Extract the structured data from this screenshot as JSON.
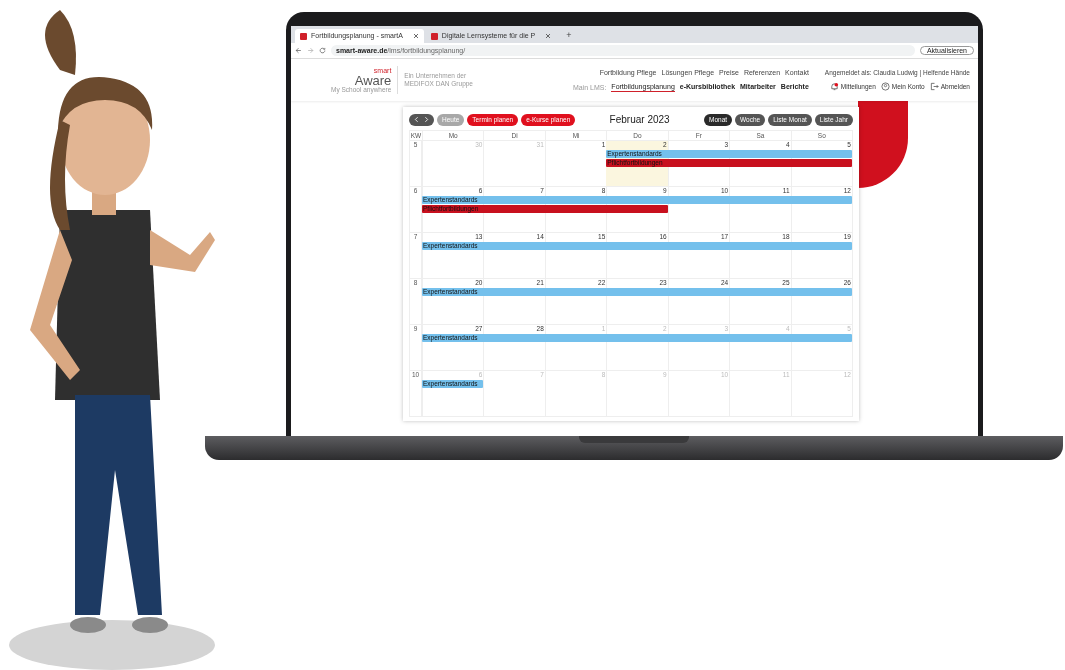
{
  "browser": {
    "tabs": [
      {
        "title": "Fortbildungsplanung - smartA",
        "selected": true
      },
      {
        "title": "Digitale Lernsysteme für die P",
        "selected": false
      }
    ],
    "new_tab": "+",
    "url_host": "smart-aware.de",
    "url_path": "/lms/fortbildungsplanung/",
    "update_button": "Aktualisieren"
  },
  "site": {
    "logo_top": "smart",
    "logo_main": "Aware",
    "logo_tagline": "My School anywhere",
    "company_note": "Ein Unternehmen der MEDIFOX DAN Gruppe",
    "top_nav": [
      "Fortbildung Pflege",
      "Lösungen Pflege",
      "Preise",
      "Referenzen",
      "Kontakt"
    ],
    "user_line": "Angemeldet als: Claudia Ludwig | Helfende Hände",
    "lms_label": "Main LMS:",
    "lms_nav": [
      {
        "label": "Fortbildungsplanung",
        "selected": true
      },
      {
        "label": "e-Kursbibliothek",
        "selected": false
      },
      {
        "label": "Mitarbeiter",
        "selected": false
      },
      {
        "label": "Berichte",
        "selected": false
      }
    ],
    "actions": [
      {
        "kind": "bell",
        "label": "Mitteilungen"
      },
      {
        "kind": "account",
        "label": "Mein Konto"
      },
      {
        "kind": "logout",
        "label": "Abmelden"
      }
    ]
  },
  "calendar": {
    "today_button": {
      "label": "Heute",
      "disabled": true
    },
    "plan_buttons": [
      "Termin planen",
      "e-Kurse planen"
    ],
    "title": "Februar 2023",
    "views": [
      {
        "label": "Monat",
        "selected": true
      },
      {
        "label": "Woche",
        "selected": false
      },
      {
        "label": "Liste Monat",
        "selected": false
      },
      {
        "label": "Liste Jahr",
        "selected": false
      }
    ],
    "week_header": "KW",
    "weekdays": [
      "Mo",
      "Di",
      "Mi",
      "Do",
      "Fr",
      "Sa",
      "So"
    ],
    "weeks": [
      {
        "kw": "5",
        "days": [
          {
            "n": "30",
            "muted": true,
            "today": false
          },
          {
            "n": "31",
            "muted": true,
            "today": false
          },
          {
            "n": "1",
            "muted": false,
            "today": false
          },
          {
            "n": "2",
            "muted": false,
            "today": true
          },
          {
            "n": "3",
            "muted": false,
            "today": false
          },
          {
            "n": "4",
            "muted": false,
            "today": false
          },
          {
            "n": "5",
            "muted": false,
            "today": false
          }
        ],
        "events": [
          {
            "label": "Expertenstandards",
            "kind": "late",
            "color": "#74c0ec"
          },
          {
            "label": "Pflichtfortbildungen",
            "kind": "late",
            "color": "#c8101e"
          }
        ]
      },
      {
        "kw": "6",
        "days": [
          {
            "n": "6",
            "muted": false,
            "today": false
          },
          {
            "n": "7",
            "muted": false,
            "today": false
          },
          {
            "n": "8",
            "muted": false,
            "today": false
          },
          {
            "n": "9",
            "muted": false,
            "today": false
          },
          {
            "n": "10",
            "muted": false,
            "today": false
          },
          {
            "n": "11",
            "muted": false,
            "today": false
          },
          {
            "n": "12",
            "muted": false,
            "today": false
          }
        ],
        "events": [
          {
            "label": "Expertenstandards",
            "kind": "week",
            "color": "#74c0ec"
          },
          {
            "label": "Pflichtfortbildungen",
            "kind": "early",
            "color": "#c8101e"
          }
        ]
      },
      {
        "kw": "7",
        "days": [
          {
            "n": "13",
            "muted": false,
            "today": false
          },
          {
            "n": "14",
            "muted": false,
            "today": false
          },
          {
            "n": "15",
            "muted": false,
            "today": false
          },
          {
            "n": "16",
            "muted": false,
            "today": false
          },
          {
            "n": "17",
            "muted": false,
            "today": false
          },
          {
            "n": "18",
            "muted": false,
            "today": false
          },
          {
            "n": "19",
            "muted": false,
            "today": false
          }
        ],
        "events": [
          {
            "label": "Expertenstandards",
            "kind": "week",
            "color": "#74c0ec"
          }
        ]
      },
      {
        "kw": "8",
        "days": [
          {
            "n": "20",
            "muted": false,
            "today": false
          },
          {
            "n": "21",
            "muted": false,
            "today": false
          },
          {
            "n": "22",
            "muted": false,
            "today": false
          },
          {
            "n": "23",
            "muted": false,
            "today": false
          },
          {
            "n": "24",
            "muted": false,
            "today": false
          },
          {
            "n": "25",
            "muted": false,
            "today": false
          },
          {
            "n": "26",
            "muted": false,
            "today": false
          }
        ],
        "events": [
          {
            "label": "Expertenstandards",
            "kind": "week",
            "color": "#74c0ec"
          }
        ]
      },
      {
        "kw": "9",
        "days": [
          {
            "n": "27",
            "muted": false,
            "today": false
          },
          {
            "n": "28",
            "muted": false,
            "today": false
          },
          {
            "n": "1",
            "muted": true,
            "today": false
          },
          {
            "n": "2",
            "muted": true,
            "today": false
          },
          {
            "n": "3",
            "muted": true,
            "today": false
          },
          {
            "n": "4",
            "muted": true,
            "today": false
          },
          {
            "n": "5",
            "muted": true,
            "today": false
          }
        ],
        "events": [
          {
            "label": "Expertenstandards",
            "kind": "week",
            "color": "#74c0ec"
          }
        ]
      },
      {
        "kw": "10",
        "days": [
          {
            "n": "6",
            "muted": true,
            "today": false
          },
          {
            "n": "7",
            "muted": true,
            "today": false
          },
          {
            "n": "8",
            "muted": true,
            "today": false
          },
          {
            "n": "9",
            "muted": true,
            "today": false
          },
          {
            "n": "10",
            "muted": true,
            "today": false
          },
          {
            "n": "11",
            "muted": true,
            "today": false
          },
          {
            "n": "12",
            "muted": true,
            "today": false
          }
        ],
        "events": [
          {
            "label": "Expertenstandards",
            "kind": "monday",
            "color": "#74c0ec"
          }
        ]
      }
    ]
  }
}
